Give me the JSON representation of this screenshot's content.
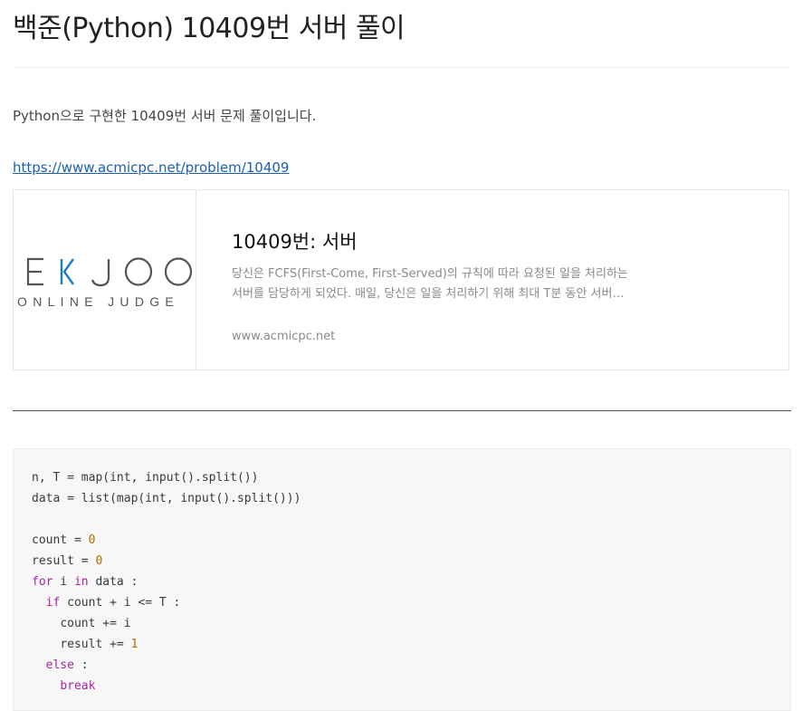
{
  "post": {
    "title": "백준(Python) 10409번 서버 풀이",
    "intro": "Python으로 구현한 10409번 서버 문제 풀이입니다.",
    "link": "https://www.acmicpc.net/problem/10409"
  },
  "card": {
    "logo_main": "E K J O O",
    "logo_sub": "ONLINE JUDGE",
    "title": "10409번: 서버",
    "desc_line1": "당신은 FCFS(First-Come, First-Served)의 규칙에 따라 요청된 일을 처리하는",
    "desc_line2": "서버를 담당하게 되었다. 매일, 당신은 일을 처리하기 위해 최대 T분 동안 서버…",
    "host": "www.acmicpc.net",
    "colors": {
      "logo_gray": "#555555",
      "logo_blue": "#1f7bc1"
    }
  },
  "code": {
    "l1": "n, T = map(int, input().split())",
    "l2": "data = list(map(int, input().split()))",
    "l4a": "count = ",
    "l4n": "0",
    "l5a": "result = ",
    "l5n": "0",
    "l6k": "for",
    "l6b": " i ",
    "l6k2": "in",
    "l6c": " data :",
    "l7k": "if",
    "l7b": " count + i <= T :",
    "l8": "count += i",
    "l9a": "result += ",
    "l9n": "1",
    "l10k": "else",
    "l10b": " :",
    "l11k": "break"
  }
}
